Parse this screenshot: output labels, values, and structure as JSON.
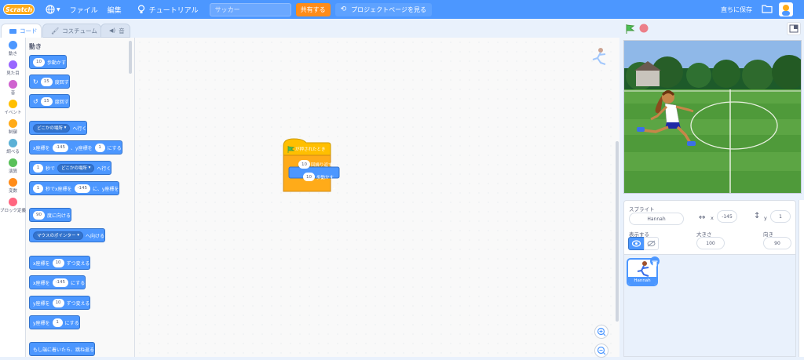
{
  "menubar": {
    "logo": "Scratch",
    "file": "ファイル",
    "edit": "編集",
    "tutorial": "チュートリアル",
    "project_title": "サッカー",
    "share": "共有する",
    "project_page": "プロジェクトページを見る",
    "save_now": "直ちに保存"
  },
  "tabs": {
    "code": "コード",
    "costumes": "コスチューム",
    "sounds": "音"
  },
  "categories": [
    {
      "label": "動き",
      "color": "#4c97ff"
    },
    {
      "label": "見た目",
      "color": "#9966ff"
    },
    {
      "label": "音",
      "color": "#cf63cf"
    },
    {
      "label": "イベント",
      "color": "#ffbf00"
    },
    {
      "label": "制御",
      "color": "#ffab19"
    },
    {
      "label": "調べる",
      "color": "#5cb1d6"
    },
    {
      "label": "演算",
      "color": "#59c059"
    },
    {
      "label": "変数",
      "color": "#ff8c1a"
    },
    {
      "label": "ブロック定義",
      "color": "#ff6680"
    }
  ],
  "palette": {
    "title": "動き",
    "move": {
      "val": "10",
      "text": "歩動かす"
    },
    "turn_right": {
      "val": "15",
      "text": "度回す"
    },
    "turn_left": {
      "val": "15",
      "text": "度回す"
    },
    "goto": {
      "drop": "どこかの場所",
      "text": "へ行く"
    },
    "goto_xy": {
      "x_label": "x座標を",
      "x": "-145",
      "y_label": "、y座標を",
      "y": "1",
      "text": "にする"
    },
    "glide_to": {
      "secs": "1",
      "secs_text": "秒で",
      "drop": "どこかの場所",
      "text": "へ行く"
    },
    "glide_xy": {
      "secs": "1",
      "text1": "秒でx座標を",
      "x": "-145",
      "text2": "に、y座標を"
    },
    "point_dir": {
      "val": "90",
      "text": "度に向ける"
    },
    "point_towards": {
      "drop": "マウスのポインター",
      "text": "へ向ける"
    },
    "change_x": {
      "label": "x座標を",
      "val": "10",
      "text": "ずつ変える"
    },
    "set_x": {
      "label": "x座標を",
      "val": "-145",
      "text": "にする"
    },
    "change_y": {
      "label": "y座標を",
      "val": "10",
      "text": "ずつ変える"
    },
    "set_y": {
      "label": "y座標を",
      "val": "1",
      "text": "にする"
    },
    "bounce": {
      "text": "もし端に着いたら、跳ね返る"
    }
  },
  "script": {
    "hat": "が押されたとき",
    "repeat_val": "10",
    "repeat_text": "回繰り返す",
    "move_val": "10",
    "move_text": "歩動かす"
  },
  "sprite_info": {
    "sprite_label": "スプライト",
    "name": "Hannah",
    "x_label": "x",
    "x": "-145",
    "y_label": "y",
    "y": "1",
    "show_label": "表示する",
    "size_label": "大きさ",
    "size": "100",
    "direction_label": "向き",
    "direction": "90"
  },
  "sprites": [
    {
      "name": "Hannah"
    }
  ]
}
